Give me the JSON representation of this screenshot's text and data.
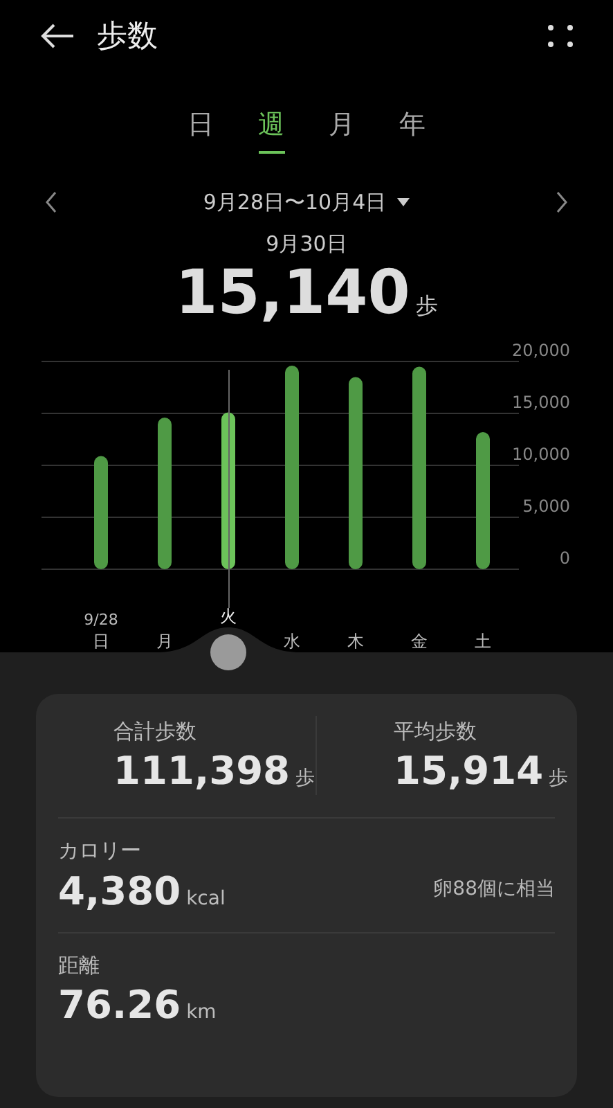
{
  "header": {
    "title": "歩数"
  },
  "tabs": [
    {
      "label": "日",
      "selected": false
    },
    {
      "label": "週",
      "selected": true
    },
    {
      "label": "月",
      "selected": false
    },
    {
      "label": "年",
      "selected": false
    }
  ],
  "period": {
    "range": "9月28日〜10月4日",
    "selected_date": "9月30日",
    "value": "15,140",
    "unit": "歩"
  },
  "chart": {
    "first_date_label": "9/28",
    "chart_data": {
      "type": "bar",
      "categories": [
        "日",
        "月",
        "火",
        "水",
        "木",
        "金",
        "土"
      ],
      "series": [
        {
          "color": "#4f9a45",
          "values": [
            10900,
            14600,
            null,
            19600,
            18500,
            19500,
            13200
          ]
        },
        {
          "color": "#6cc35a",
          "values": [
            null,
            null,
            15100,
            null,
            null,
            null,
            null
          ]
        }
      ],
      "stacked": true,
      "grid": true,
      "ylim": [
        0,
        20000
      ],
      "yticks": [
        {
          "value": 0,
          "label": "0"
        },
        {
          "value": 5000,
          "label": "5,000"
        },
        {
          "value": 10000,
          "label": "10,000"
        },
        {
          "value": 15000,
          "label": "15,000"
        },
        {
          "value": 20000,
          "label": "20,000"
        }
      ]
    }
  },
  "summary": {
    "total": {
      "label": "合計歩数",
      "value": "111,398",
      "unit": "歩"
    },
    "average": {
      "label": "平均歩数",
      "value": "15,914",
      "unit": "歩"
    },
    "calories": {
      "label": "カロリー",
      "value": "4,380",
      "unit": "kcal",
      "note": "卵88個に相当"
    },
    "distance": {
      "label": "距離",
      "value": "76.26",
      "unit": "km"
    }
  }
}
